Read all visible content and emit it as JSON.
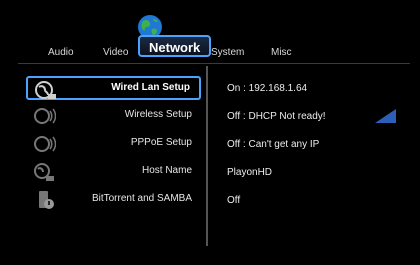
{
  "tabs": [
    {
      "label": "Audio"
    },
    {
      "label": "Video"
    },
    {
      "label": "Network"
    },
    {
      "label": "System"
    },
    {
      "label": "Misc"
    }
  ],
  "active_tab": "Network",
  "menu": [
    {
      "label": "Wired Lan Setup",
      "value": "On : 192.168.1.64",
      "icon": "wired-lan-icon"
    },
    {
      "label": "Wireless Setup",
      "value": "Off : DHCP Not ready!",
      "icon": "wireless-icon"
    },
    {
      "label": "PPPoE Setup",
      "value": "Off : Can't get any IP",
      "icon": "pppoe-icon"
    },
    {
      "label": "Host Name",
      "value": "PlayonHD",
      "icon": "host-name-icon"
    },
    {
      "label": "BitTorrent and SAMBA",
      "value": "Off",
      "icon": "bittorrent-samba-icon"
    }
  ],
  "colors": {
    "accent": "#4aa3ff",
    "background": "#000000",
    "signal": "#2b5fb8"
  }
}
